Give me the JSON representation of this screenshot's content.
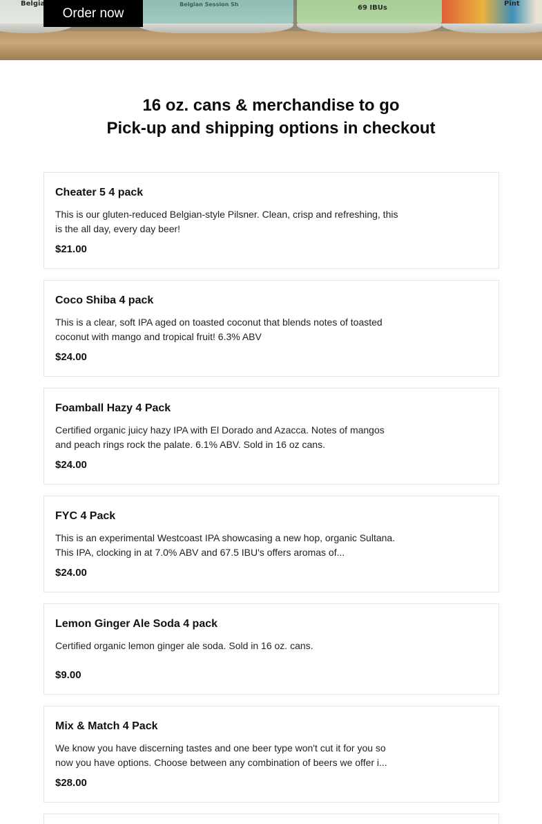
{
  "hero": {
    "can_texts": [
      "Belgia",
      "Belgian Session Sh",
      "69 IBUs",
      "Pint"
    ]
  },
  "order_button": "Order now",
  "heading": {
    "line1": "16 oz. cans & merchandise to go",
    "line2": "Pick-up and shipping options in checkout"
  },
  "products": [
    {
      "name": "Cheater 5 4 pack",
      "description": "This is our gluten-reduced Belgian-style Pilsner. Clean, crisp and refreshing, this is the all day, every day beer!",
      "price": "$21.00"
    },
    {
      "name": "Coco Shiba 4 pack",
      "description": "This is a clear, soft IPA aged on toasted coconut that blends notes of toasted coconut with mango and tropical fruit! 6.3% ABV",
      "price": "$24.00"
    },
    {
      "name": "Foamball Hazy 4 Pack",
      "description": "Certified organic juicy hazy IPA with El Dorado and Azacca. Notes of mangos and peach rings rock the palate. 6.1% ABV. Sold in 16 oz cans.",
      "price": "$24.00"
    },
    {
      "name": "FYC 4 Pack",
      "description": "This is an experimental Westcoast IPA showcasing a new hop, organic Sultana. This IPA, clocking in at 7.0% ABV and 67.5 IBU's offers aromas of...",
      "price": "$24.00"
    },
    {
      "name": "Lemon Ginger Ale Soda 4 pack",
      "description": "Certified organic lemon ginger ale soda. Sold in 16 oz. cans.",
      "price": "$9.00"
    },
    {
      "name": "Mix & Match 4 Pack",
      "description": "We know you have discerning tastes and one beer type won't cut it for you so now you have options. Choose between any combination of beers we offer i...",
      "price": "$28.00"
    }
  ]
}
